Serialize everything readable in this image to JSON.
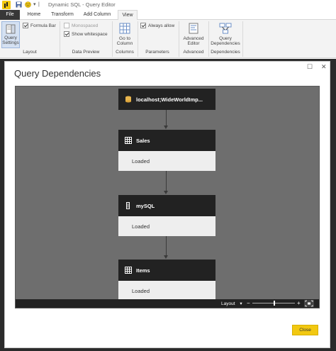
{
  "window": {
    "title": "Dynamic SQL - Query Editor",
    "quick_access_separator": "|",
    "quick_access_dropdown": "▾"
  },
  "tabs": [
    {
      "label": "File"
    },
    {
      "label": "Home"
    },
    {
      "label": "Transform"
    },
    {
      "label": "Add Column"
    },
    {
      "label": "View"
    }
  ],
  "ribbon": {
    "layout": {
      "query_settings_label": "Query Settings",
      "formula_bar_label": "Formula Bar",
      "formula_bar_checked": true,
      "group_label": "Layout"
    },
    "data_preview": {
      "monospaced_label": "Monospaced",
      "monospaced_checked": false,
      "show_whitespace_label": "Show whitespace",
      "show_whitespace_checked": true,
      "group_label": "Data Preview"
    },
    "columns": {
      "go_to_column_label": "Go to Column",
      "group_label": "Columns"
    },
    "parameters": {
      "always_allow_label": "Always allow",
      "always_allow_checked": true,
      "group_label": "Parameters"
    },
    "advanced": {
      "advanced_editor_label": "Advanced Editor",
      "group_label": "Advanced"
    },
    "dependencies": {
      "query_dependencies_label": "Query Dependencies",
      "group_label": "Dependencies"
    }
  },
  "dialog": {
    "title": "Query Dependencies",
    "maximize_glyph": "☐",
    "close_glyph": "✕",
    "nodes": [
      {
        "title": "localhost;WideWorldImp...",
        "icon": "database-icon"
      },
      {
        "title": "Sales",
        "icon": "table-icon",
        "status": "Loaded"
      },
      {
        "title": "mySQL",
        "icon": "query-icon",
        "status": "Loaded"
      },
      {
        "title": "Items",
        "icon": "table-icon",
        "status": "Loaded"
      }
    ],
    "bottom_bar": {
      "layout_label": "Layout",
      "layout_dropdown": "▾",
      "zoom_minus": "−",
      "zoom_plus": "+"
    },
    "close_button_label": "Close"
  },
  "colors": {
    "node_header": "#222222",
    "node_body": "#eeeeee",
    "canvas": "#6e6e6e",
    "accent_button": "#f2c811",
    "file_tab": "#373737",
    "backdrop": "#2b2b2b"
  }
}
